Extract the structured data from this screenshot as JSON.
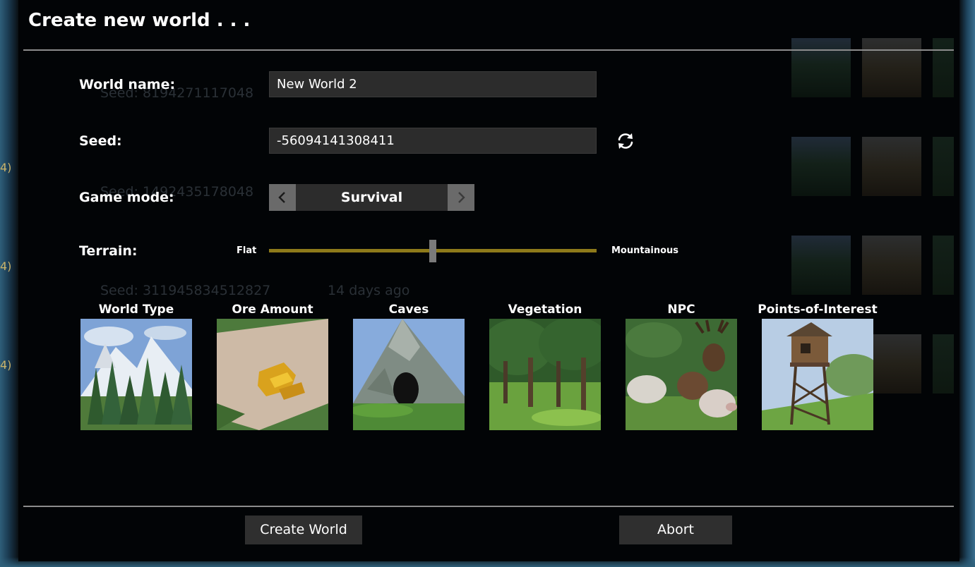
{
  "dialog": {
    "title": "Create new world . . ."
  },
  "form": {
    "world_name_label": "World name:",
    "world_name_value": "New World 2",
    "seed_label": "Seed:",
    "seed_value": "-56094141308411",
    "refresh_icon": "refresh-icon",
    "game_mode_label": "Game mode:",
    "game_mode_value": "Survival",
    "terrain_label": "Terrain:",
    "terrain_min_label": "Flat",
    "terrain_max_label": "Mountainous",
    "terrain_level": 0.5
  },
  "options": [
    {
      "label": "World Type",
      "icon": "forest-mountain-image"
    },
    {
      "label": "Ore Amount",
      "icon": "gold-ore-image"
    },
    {
      "label": "Caves",
      "icon": "cave-image"
    },
    {
      "label": "Vegetation",
      "icon": "trees-image"
    },
    {
      "label": "NPC",
      "icon": "animals-image"
    },
    {
      "label": "Points-of-Interest",
      "icon": "watchtower-image"
    }
  ],
  "footer": {
    "create_label": "Create World",
    "abort_label": "Abort"
  },
  "background": {
    "ghost_lines": [
      "Seed: 8194271117048",
      "Seed: 1492435178048",
      "Seed: 311945834512827",
      "14 days ago"
    ],
    "side_marks": [
      "4)",
      "4)",
      "4)"
    ]
  },
  "colors": {
    "panel": "#020406",
    "field": "#2c2c2c",
    "slider_track": "#8e7a1a",
    "accent_border": "#2f5f7a"
  }
}
